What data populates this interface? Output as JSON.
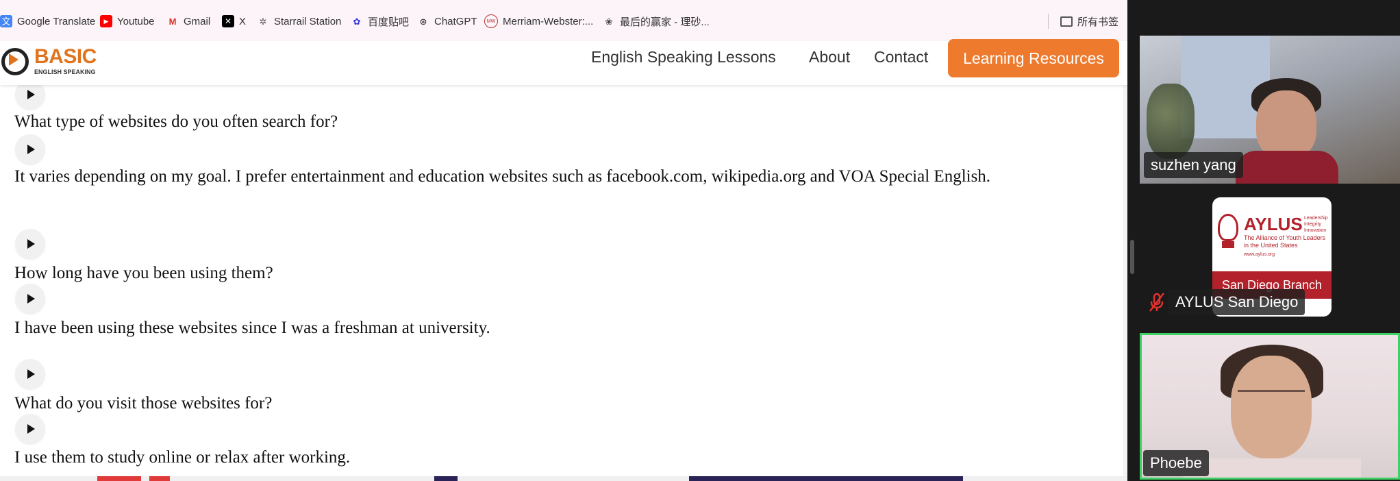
{
  "bookmarks": [
    {
      "label": "Google Translate",
      "icon": "google-translate-icon"
    },
    {
      "label": "Youtube",
      "icon": "youtube-icon"
    },
    {
      "label": "Gmail",
      "icon": "gmail-icon"
    },
    {
      "label": "X",
      "icon": "x-icon"
    },
    {
      "label": "Starrail Station",
      "icon": "starrail-icon"
    },
    {
      "label": "百度贴吧",
      "icon": "baidu-icon"
    },
    {
      "label": "ChatGPT",
      "icon": "chatgpt-icon"
    },
    {
      "label": "Merriam-Webster:...",
      "icon": "merriam-webster-icon"
    },
    {
      "label": "最后的赢家 - 理砂...",
      "icon": "book-icon"
    }
  ],
  "bookmarks_all": {
    "label": "所有书签",
    "icon": "folder-icon"
  },
  "site": {
    "logo_text": "BASIC",
    "logo_sub": "ENGLISH SPEAKING",
    "nav": [
      "English Speaking Lessons",
      "About",
      "Contact"
    ],
    "cta": "Learning Resources",
    "accent_color": "#EE7A2E"
  },
  "lessons": [
    {
      "text": "What type of websites do you often search for?"
    },
    {
      "text": "It varies depending on my goal. I prefer entertainment and education websites such as facebook.com, wikipedia.org and VOA Special English."
    },
    {
      "text": "How long have you been using them?"
    },
    {
      "text": "I have been using these websites since I was a freshman at university."
    },
    {
      "text": "What do you visit those websites for?"
    },
    {
      "text": "I use them to study online or relax after working."
    }
  ],
  "participants": [
    {
      "name": "suzhen  yang",
      "muted": false
    },
    {
      "name": "AYLUS San Diego",
      "muted": true
    },
    {
      "name": "Phoebe",
      "muted": false,
      "active_speaker": true
    }
  ],
  "aylus_card": {
    "title": "AYLUS",
    "side_lines": [
      "Leadership",
      "Integrity",
      "Innovation"
    ],
    "subtitle": "The Alliance of Youth Leaders in the United States",
    "url": "www.aylus.org",
    "branch": "San Diego Branch",
    "brand_color": "#B3212B"
  }
}
